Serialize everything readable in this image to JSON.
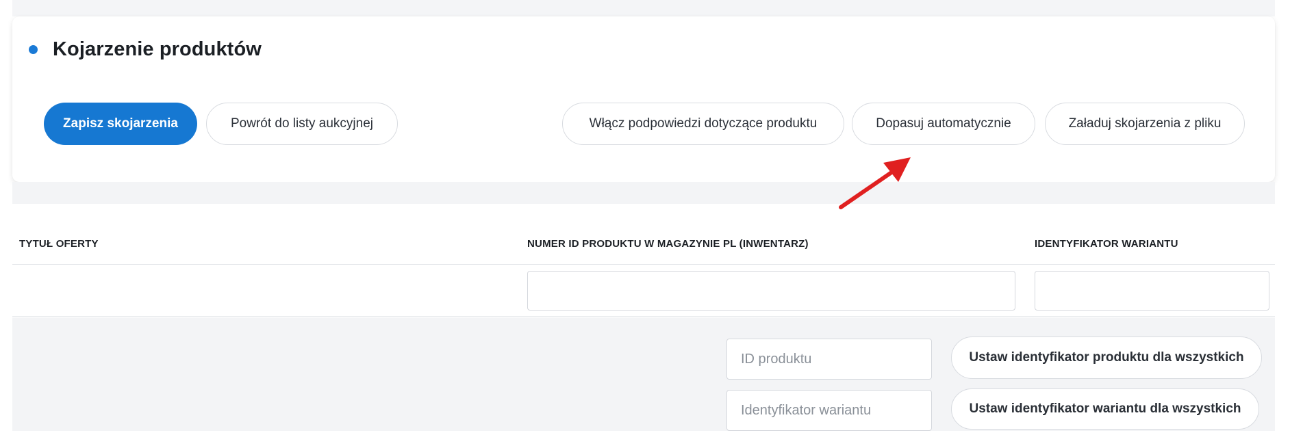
{
  "header": {
    "title": "Kojarzenie produktów",
    "accent_color": "#1678d2",
    "buttons": {
      "save": "Zapisz skojarzenia",
      "back": "Powrót do listy aukcyjnej",
      "hints": "Włącz podpowiedzi dotyczące produktu",
      "auto_match": "Dopasuj automatycznie",
      "load_file": "Załaduj skojarzenia z pliku"
    }
  },
  "table": {
    "columns": [
      "TYTUŁ OFERTY",
      "NUMER ID PRODUKTU W MAGAZYNIE PL (INWENTARZ)",
      "IDENTYFIKATOR WARIANTU"
    ],
    "row": {
      "offer_title": "",
      "product_id_value": "",
      "variant_id_value": ""
    }
  },
  "bulk": {
    "product_id_placeholder": "ID produktu",
    "variant_id_placeholder": "Identyfikator wariantu",
    "set_product_label": "Ustaw identyfikator produktu dla wszystkich",
    "set_variant_label": "Ustaw identyfikator wariantu dla wszystkich"
  },
  "annotation": {
    "arrow_color": "#e02020",
    "arrow_icon": "red-arrow-icon"
  }
}
